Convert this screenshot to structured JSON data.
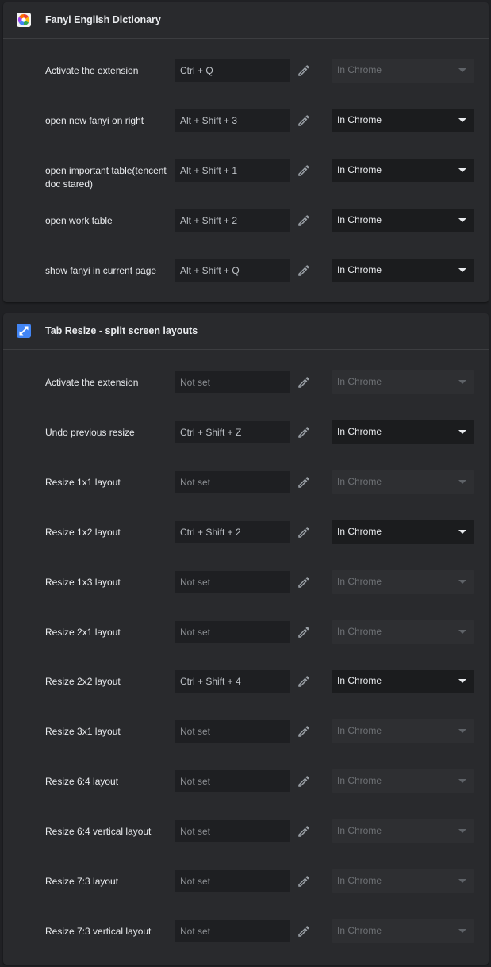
{
  "extensions": [
    {
      "name": "Fanyi English Dictionary",
      "icon": "fanyi-logo-icon",
      "commands": [
        {
          "label": "Activate the extension",
          "shortcut": "Ctrl + Q",
          "scope": "In Chrome",
          "scope_enabled": false
        },
        {
          "label": "open new fanyi on right",
          "shortcut": "Alt + Shift + 3",
          "scope": "In Chrome",
          "scope_enabled": true
        },
        {
          "label": "open important table(tencent doc stared)",
          "shortcut": "Alt + Shift + 1",
          "scope": "In Chrome",
          "scope_enabled": true
        },
        {
          "label": "open work table",
          "shortcut": "Alt + Shift + 2",
          "scope": "In Chrome",
          "scope_enabled": true
        },
        {
          "label": "show fanyi in current page",
          "shortcut": "Alt + Shift + Q",
          "scope": "In Chrome",
          "scope_enabled": true
        }
      ]
    },
    {
      "name": "Tab Resize - split screen layouts",
      "icon": "resize-arrows-icon",
      "commands": [
        {
          "label": "Activate the extension",
          "shortcut": "Not set",
          "scope": "In Chrome",
          "scope_enabled": false
        },
        {
          "label": "Undo previous resize",
          "shortcut": "Ctrl + Shift + Z",
          "scope": "In Chrome",
          "scope_enabled": true
        },
        {
          "label": "Resize 1x1 layout",
          "shortcut": "Not set",
          "scope": "In Chrome",
          "scope_enabled": false
        },
        {
          "label": "Resize 1x2 layout",
          "shortcut": "Ctrl + Shift + 2",
          "scope": "In Chrome",
          "scope_enabled": true
        },
        {
          "label": "Resize 1x3 layout",
          "shortcut": "Not set",
          "scope": "In Chrome",
          "scope_enabled": false
        },
        {
          "label": "Resize 2x1 layout",
          "shortcut": "Not set",
          "scope": "In Chrome",
          "scope_enabled": false
        },
        {
          "label": "Resize 2x2 layout",
          "shortcut": "Ctrl + Shift + 4",
          "scope": "In Chrome",
          "scope_enabled": true
        },
        {
          "label": "Resize 3x1 layout",
          "shortcut": "Not set",
          "scope": "In Chrome",
          "scope_enabled": false
        },
        {
          "label": "Resize 6:4 layout",
          "shortcut": "Not set",
          "scope": "In Chrome",
          "scope_enabled": false
        },
        {
          "label": "Resize 6:4 vertical layout",
          "shortcut": "Not set",
          "scope": "In Chrome",
          "scope_enabled": false
        },
        {
          "label": "Resize 7:3 layout",
          "shortcut": "Not set",
          "scope": "In Chrome",
          "scope_enabled": false
        },
        {
          "label": "Resize 7:3 vertical layout",
          "shortcut": "Not set",
          "scope": "In Chrome",
          "scope_enabled": false
        }
      ]
    }
  ],
  "colors": {
    "page_bg": "#202124",
    "card_bg": "#292a2d",
    "field_bg": "#1e1f22",
    "text": "#e8eaed",
    "accent_blue": "#4285f4"
  }
}
